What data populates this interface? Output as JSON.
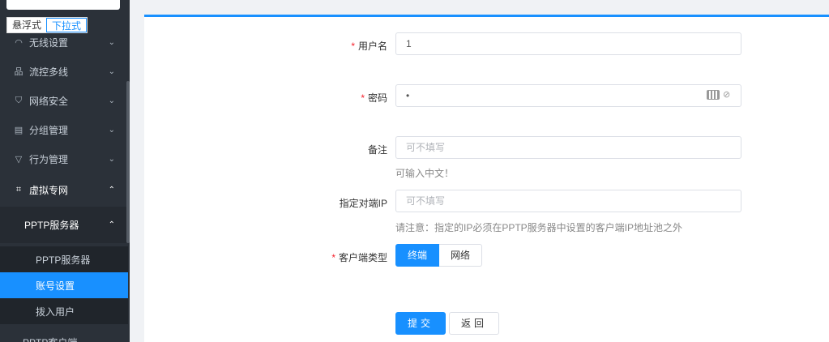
{
  "sidebar": {
    "mode_switch": [
      "悬浮式",
      "下拉式"
    ],
    "menu": [
      {
        "label": "无线设置",
        "icon": "wifi-icon"
      },
      {
        "label": "流控多线",
        "icon": "network-icon"
      },
      {
        "label": "网络安全",
        "icon": "shield-icon"
      },
      {
        "label": "分组管理",
        "icon": "book-icon"
      },
      {
        "label": "行为管理",
        "icon": "filter-icon"
      },
      {
        "label": "虚拟专网",
        "icon": "vpn-icon"
      }
    ],
    "sub_group": "PPTP服务器",
    "sub_items": [
      "PPTP服务器",
      "账号设置",
      "拨入用户"
    ],
    "cut_item": "PPTP客户端"
  },
  "form": {
    "username": {
      "label": "用户名",
      "value": "1"
    },
    "password": {
      "label": "密码",
      "value": "•"
    },
    "remark": {
      "label": "备注",
      "placeholder": "可不填写",
      "hint": "可输入中文！"
    },
    "peer_ip": {
      "label": "指定对端IP",
      "placeholder": "可不填写",
      "hint": "请注意：指定的IP必须在PPTP服务器中设置的客户端IP地址池之外"
    },
    "client_type": {
      "label": "客户端类型",
      "options": [
        "终端",
        "网络"
      ],
      "selected": "终端"
    },
    "submit_label": "提交",
    "back_label": "返回"
  },
  "colors": {
    "accent": "#1890ff",
    "sidebar_bg": "#2b3139",
    "required": "#f5222d"
  }
}
